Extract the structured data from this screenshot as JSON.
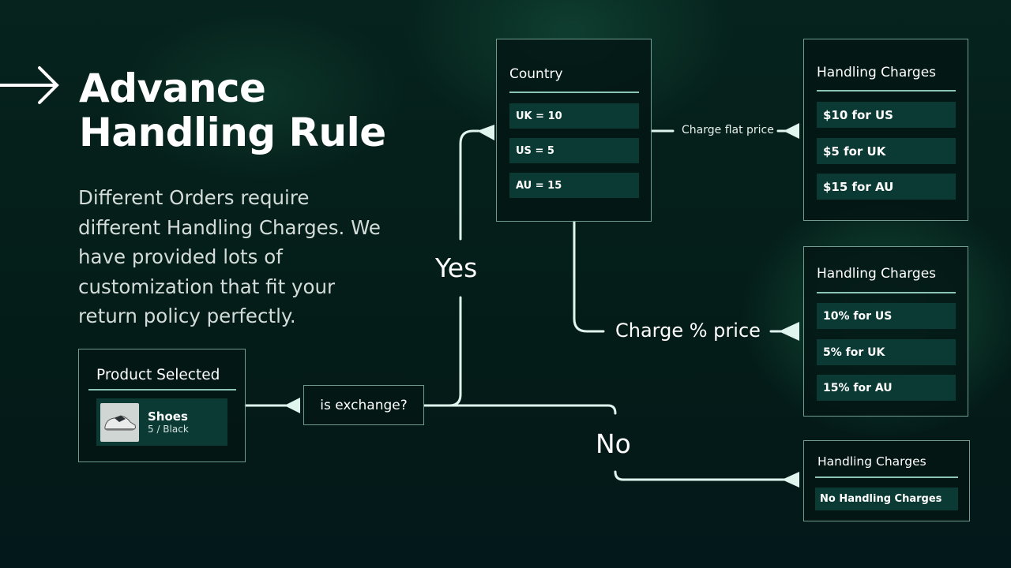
{
  "header": {
    "arrow_icon": "arrow-right-icon",
    "title_line1": "Advance",
    "title_line2": "Handling Rule",
    "description": "Different Orders require different Handling Charges. We have provided lots of customization that fit your return policy perfectly."
  },
  "product_card": {
    "title": "Product Selected",
    "item": {
      "image_icon": "shoe-image",
      "name": "Shoes",
      "variant": "5 / Black"
    }
  },
  "decision": {
    "question": "is exchange?",
    "yes_label": "Yes",
    "no_label": "No"
  },
  "country_card": {
    "title": "Country",
    "rows": [
      "UK = 10",
      "US = 5",
      "AU = 15"
    ]
  },
  "flat_branch": {
    "label": "Charge flat price",
    "card": {
      "title": "Handling Charges",
      "rows": [
        "$10 for US",
        "$5 for UK",
        "$15 for AU"
      ]
    }
  },
  "percent_branch": {
    "label": "Charge % price",
    "card": {
      "title": "Handling Charges",
      "rows": [
        "10% for US",
        "5% for UK",
        "15% for AU"
      ]
    }
  },
  "no_branch": {
    "card": {
      "title": "Handling Charges",
      "rows": [
        "No Handling Charges"
      ]
    }
  },
  "colors": {
    "background": "#041c18",
    "wire": "#dff5ee",
    "card_border": "#6f9c8f",
    "row_fill": "#0b3a35",
    "rule": "#8bc7b4"
  }
}
